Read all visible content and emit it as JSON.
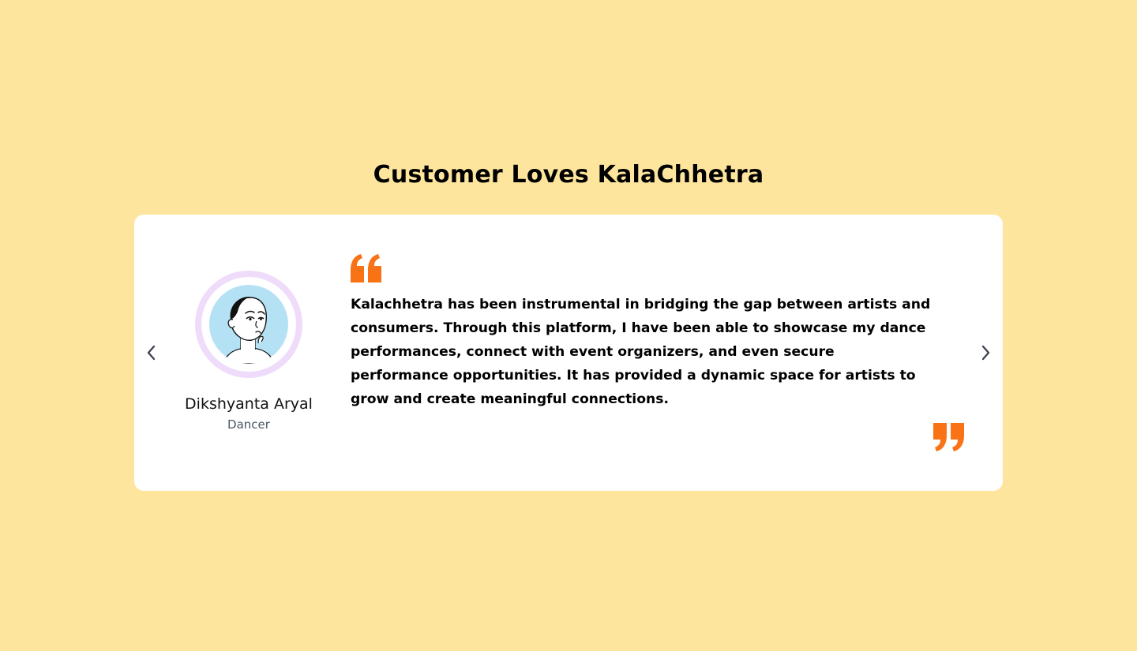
{
  "page": {
    "background_color": "#FEE59E",
    "heading": "Customer Loves KalaChhetra"
  },
  "carousel": {
    "prev_icon": "chevron-left-icon",
    "next_icon": "chevron-right-icon",
    "accent_color": "#F97316"
  },
  "testimonial": {
    "author_name": "Dikshyanta Aryal",
    "author_role": "Dancer",
    "quote": "Kalachhetra has been instrumental in bridging the gap between artists and consumers. Through this platform, I have been able to showcase my dance performances, connect with event organizers, and even secure performance opportunities. It has provided a dynamic space for artists to grow and create meaningful connections.",
    "open_quote_icon": "quote-open-icon",
    "close_quote_icon": "quote-close-icon",
    "avatar_icon": "avatar-illustration"
  }
}
